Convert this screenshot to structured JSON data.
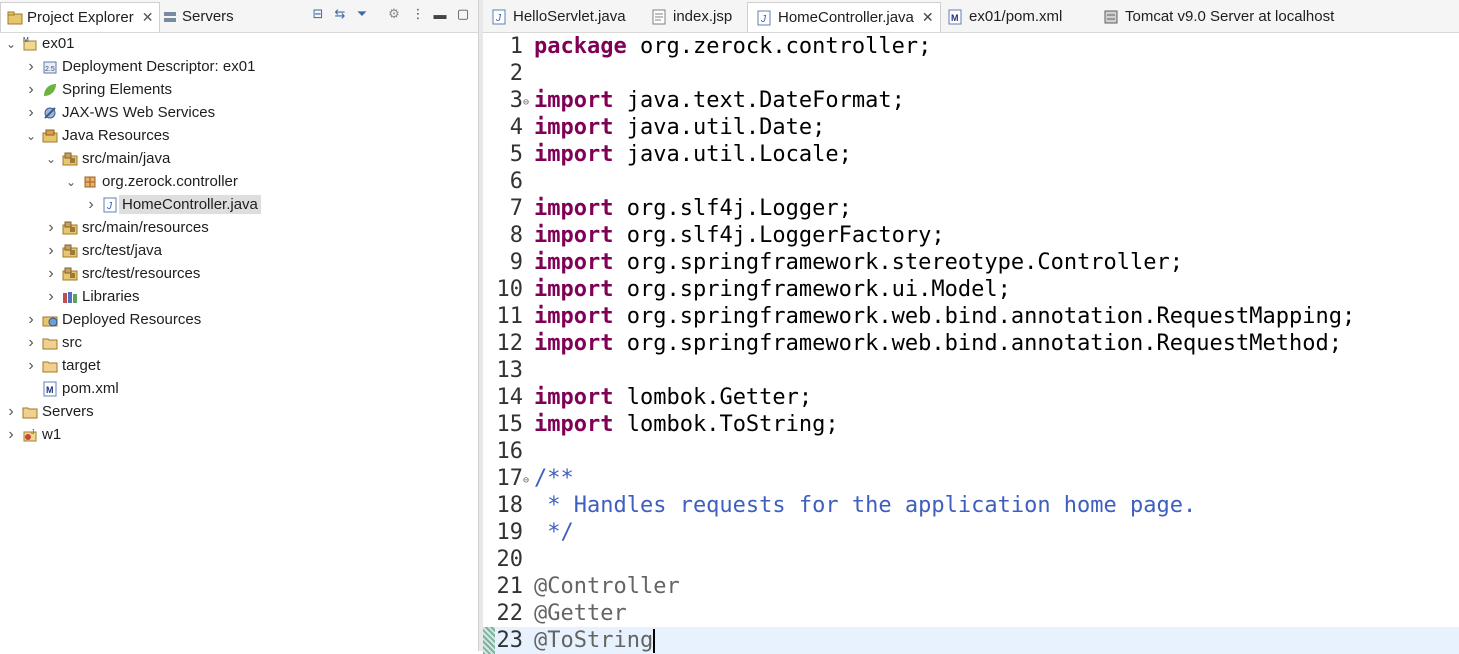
{
  "left_panel": {
    "tabs": [
      {
        "label": "Project Explorer",
        "icon": "project-explorer-icon",
        "closable": true
      },
      {
        "label": "Servers",
        "icon": "servers-icon",
        "closable": false
      }
    ],
    "toolbar": [
      "collapse-all-icon",
      "link-with-editor-icon",
      "filter-icon",
      "settings-icon",
      "view-menu-icon",
      "minimize-icon",
      "maximize-icon"
    ],
    "tree": [
      {
        "label": "ex01",
        "depth": 0,
        "expanded": true,
        "icon": "maven-project-icon"
      },
      {
        "label": "Deployment Descriptor: ex01",
        "depth": 1,
        "expanded": false,
        "icon": "deployment-descriptor-icon"
      },
      {
        "label": "Spring Elements",
        "depth": 1,
        "expanded": false,
        "icon": "spring-leaf-icon"
      },
      {
        "label": "JAX-WS Web Services",
        "depth": 1,
        "expanded": false,
        "icon": "web-services-icon"
      },
      {
        "label": "Java Resources",
        "depth": 1,
        "expanded": true,
        "icon": "java-resources-icon"
      },
      {
        "label": "src/main/java",
        "depth": 2,
        "expanded": true,
        "icon": "source-folder-icon"
      },
      {
        "label": "org.zerock.controller",
        "depth": 3,
        "expanded": true,
        "icon": "package-icon"
      },
      {
        "label": "HomeController.java",
        "depth": 4,
        "expanded": false,
        "icon": "java-file-icon",
        "selected": true
      },
      {
        "label": "src/main/resources",
        "depth": 2,
        "expanded": false,
        "icon": "source-folder-icon"
      },
      {
        "label": "src/test/java",
        "depth": 2,
        "expanded": false,
        "icon": "source-folder-icon"
      },
      {
        "label": "src/test/resources",
        "depth": 2,
        "expanded": false,
        "icon": "source-folder-icon"
      },
      {
        "label": "Libraries",
        "depth": 2,
        "expanded": false,
        "icon": "libraries-icon"
      },
      {
        "label": "Deployed Resources",
        "depth": 1,
        "expanded": false,
        "icon": "deployed-resources-icon"
      },
      {
        "label": "src",
        "depth": 1,
        "expanded": false,
        "icon": "folder-icon"
      },
      {
        "label": "target",
        "depth": 1,
        "expanded": false,
        "icon": "folder-icon"
      },
      {
        "label": "pom.xml",
        "depth": 1,
        "leaf": true,
        "icon": "maven-pom-icon"
      },
      {
        "label": "Servers",
        "depth": 0,
        "expanded": false,
        "icon": "folder-icon"
      },
      {
        "label": "w1",
        "depth": 0,
        "expanded": false,
        "icon": "web-project-icon"
      }
    ]
  },
  "editor": {
    "tabs": [
      {
        "label": "HelloServlet.java",
        "icon": "java-file-icon"
      },
      {
        "label": "index.jsp",
        "icon": "jsp-file-icon"
      },
      {
        "label": "HomeController.java",
        "icon": "java-file-icon",
        "active": true
      },
      {
        "label": "ex01/pom.xml",
        "icon": "maven-pom-icon"
      },
      {
        "label": "Tomcat v9.0 Server at localhost",
        "icon": "server-icon"
      }
    ],
    "lines": [
      {
        "n": "1",
        "fold": "",
        "tokens": [
          [
            "kw",
            "package"
          ],
          [
            "pl",
            " org.zerock.controller;"
          ]
        ]
      },
      {
        "n": "2",
        "fold": "",
        "tokens": []
      },
      {
        "n": "3",
        "fold": "⊖",
        "tokens": [
          [
            "kw",
            "import"
          ],
          [
            "pl",
            " java.text.DateFormat;"
          ]
        ]
      },
      {
        "n": "4",
        "fold": "",
        "tokens": [
          [
            "kw",
            "import"
          ],
          [
            "pl",
            " java.util.Date;"
          ]
        ]
      },
      {
        "n": "5",
        "fold": "",
        "tokens": [
          [
            "kw",
            "import"
          ],
          [
            "pl",
            " java.util.Locale;"
          ]
        ]
      },
      {
        "n": "6",
        "fold": "",
        "tokens": []
      },
      {
        "n": "7",
        "fold": "",
        "tokens": [
          [
            "kw",
            "import"
          ],
          [
            "pl",
            " org.slf4j.Logger;"
          ]
        ]
      },
      {
        "n": "8",
        "fold": "",
        "tokens": [
          [
            "kw",
            "import"
          ],
          [
            "pl",
            " org.slf4j.LoggerFactory;"
          ]
        ]
      },
      {
        "n": "9",
        "fold": "",
        "tokens": [
          [
            "kw",
            "import"
          ],
          [
            "pl",
            " org.springframework.stereotype.Controller;"
          ]
        ]
      },
      {
        "n": "10",
        "fold": "",
        "tokens": [
          [
            "kw",
            "import"
          ],
          [
            "pl",
            " org.springframework.ui.Model;"
          ]
        ]
      },
      {
        "n": "11",
        "fold": "",
        "tokens": [
          [
            "kw",
            "import"
          ],
          [
            "pl",
            " org.springframework.web.bind.annotation.RequestMapping;"
          ]
        ]
      },
      {
        "n": "12",
        "fold": "",
        "tokens": [
          [
            "kw",
            "import"
          ],
          [
            "pl",
            " org.springframework.web.bind.annotation.RequestMethod;"
          ]
        ]
      },
      {
        "n": "13",
        "fold": "",
        "tokens": []
      },
      {
        "n": "14",
        "fold": "",
        "tokens": [
          [
            "kw",
            "import"
          ],
          [
            "pl",
            " lombok.Getter;"
          ]
        ]
      },
      {
        "n": "15",
        "fold": "",
        "tokens": [
          [
            "kw",
            "import"
          ],
          [
            "pl",
            " lombok.ToString;"
          ]
        ]
      },
      {
        "n": "16",
        "fold": "",
        "tokens": []
      },
      {
        "n": "17",
        "fold": "⊖",
        "tokens": [
          [
            "jd",
            "/**"
          ]
        ]
      },
      {
        "n": "18",
        "fold": "",
        "tokens": [
          [
            "jd",
            " * Handles requests for the application home page."
          ]
        ]
      },
      {
        "n": "19",
        "fold": "",
        "tokens": [
          [
            "jd",
            " */"
          ]
        ]
      },
      {
        "n": "20",
        "fold": "",
        "tokens": []
      },
      {
        "n": "21",
        "fold": "",
        "tokens": [
          [
            "an",
            "@Controller"
          ]
        ]
      },
      {
        "n": "22",
        "fold": "",
        "tokens": [
          [
            "an",
            "@Getter"
          ]
        ]
      },
      {
        "n": "23",
        "fold": "",
        "tokens": [
          [
            "an",
            "@ToString"
          ]
        ],
        "current": true
      }
    ]
  }
}
